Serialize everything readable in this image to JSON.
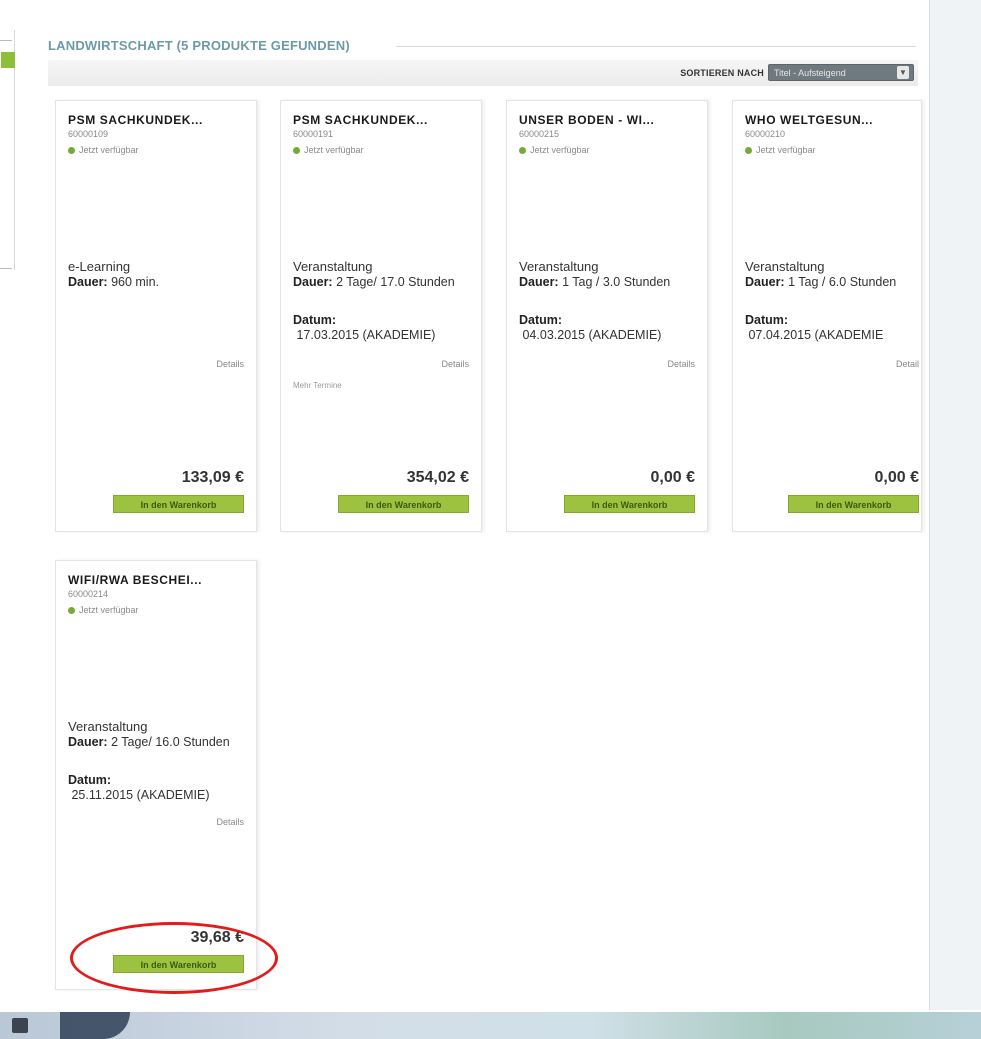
{
  "header": {
    "title": "LANDWIRTSCHAFT (5 PRODUKTE GEFUNDEN)"
  },
  "sort": {
    "label": "SORTIEREN NACH",
    "selected": "Titel - Aufsteigend",
    "arrow": "▼"
  },
  "products": [
    {
      "title": "PSM SACHKUNDEK...",
      "code": "60000109",
      "availability": "Jetzt verfügbar",
      "type": "e-Learning",
      "duration_label": "Dauer:",
      "duration": " 960 min.",
      "details": "Details",
      "price": "133,09 €",
      "cart": "In den Warenkorb"
    },
    {
      "title": "PSM SACHKUNDEK...",
      "code": "60000191",
      "availability": "Jetzt verfügbar",
      "type": "Veranstaltung",
      "duration_label": "Dauer:",
      "duration": " 2 Tage/ 17.0 Stunden",
      "date_label": "Datum:",
      "date": "17.03.2015 (AKADEMIE)",
      "details": "Details",
      "more": "Mehr Termine",
      "price": "354,02 €",
      "cart": "In den Warenkorb"
    },
    {
      "title": "UNSER BODEN - WI...",
      "code": "60000215",
      "availability": "Jetzt verfügbar",
      "type": "Veranstaltung",
      "duration_label": "Dauer:",
      "duration": " 1 Tag / 3.0 Stunden",
      "date_label": "Datum:",
      "date": "04.03.2015 (AKADEMIE)",
      "details": "Details",
      "price": "0,00 €",
      "cart": "In den Warenkorb"
    },
    {
      "title": "WHO WELTGESUN...",
      "code": "60000210",
      "availability": "Jetzt verfügbar",
      "type": "Veranstaltung",
      "duration_label": "Dauer:",
      "duration": " 1 Tag / 6.0 Stunden",
      "date_label": "Datum:",
      "date": "07.04.2015 (AKADEMIE",
      "details": "Detail",
      "price": "0,00 €",
      "cart": "In den Warenkorb"
    },
    {
      "title": "WIFI/RWA BESCHEI...",
      "code": "60000214",
      "availability": "Jetzt verfügbar",
      "type": "Veranstaltung",
      "duration_label": "Dauer:",
      "duration": " 2 Tage/ 16.0 Stunden",
      "date_label": "Datum:",
      "date": "25.11.2015 (AKADEMIE)",
      "details": "Details",
      "price": "39,68 €",
      "cart": "In den Warenkorb"
    }
  ],
  "colors": {
    "accent": "#8dbf3a",
    "cart_button": "#9cc23f",
    "highlight_circle": "#e31b1b"
  }
}
